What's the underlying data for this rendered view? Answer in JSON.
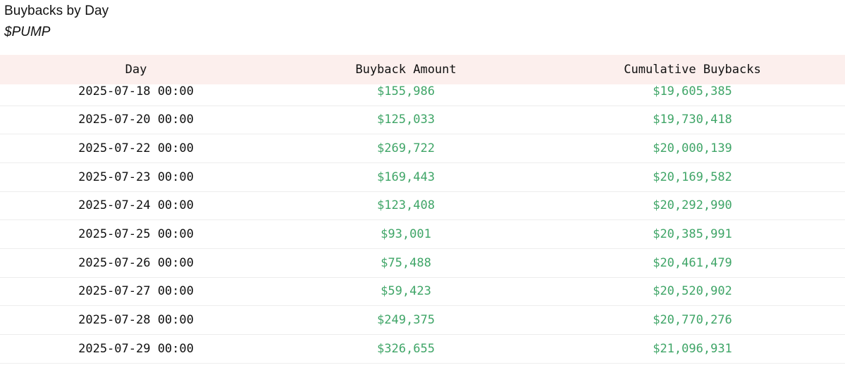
{
  "title": "Buybacks by Day",
  "subtitle": "$PUMP",
  "colors": {
    "header_bg": "#fcefed",
    "amount_green": "#3fa567"
  },
  "table": {
    "columns": [
      "Day",
      "Buyback Amount",
      "Cumulative Buybacks"
    ],
    "rows": [
      {
        "day": "2025-07-18 00:00",
        "amount": "$155,986",
        "cumulative": "$19,605,385"
      },
      {
        "day": "2025-07-20 00:00",
        "amount": "$125,033",
        "cumulative": "$19,730,418"
      },
      {
        "day": "2025-07-22 00:00",
        "amount": "$269,722",
        "cumulative": "$20,000,139"
      },
      {
        "day": "2025-07-23 00:00",
        "amount": "$169,443",
        "cumulative": "$20,169,582"
      },
      {
        "day": "2025-07-24 00:00",
        "amount": "$123,408",
        "cumulative": "$20,292,990"
      },
      {
        "day": "2025-07-25 00:00",
        "amount": "$93,001",
        "cumulative": "$20,385,991"
      },
      {
        "day": "2025-07-26 00:00",
        "amount": "$75,488",
        "cumulative": "$20,461,479"
      },
      {
        "day": "2025-07-27 00:00",
        "amount": "$59,423",
        "cumulative": "$20,520,902"
      },
      {
        "day": "2025-07-28 00:00",
        "amount": "$249,375",
        "cumulative": "$20,770,276"
      },
      {
        "day": "2025-07-29 00:00",
        "amount": "$326,655",
        "cumulative": "$21,096,931"
      }
    ]
  }
}
